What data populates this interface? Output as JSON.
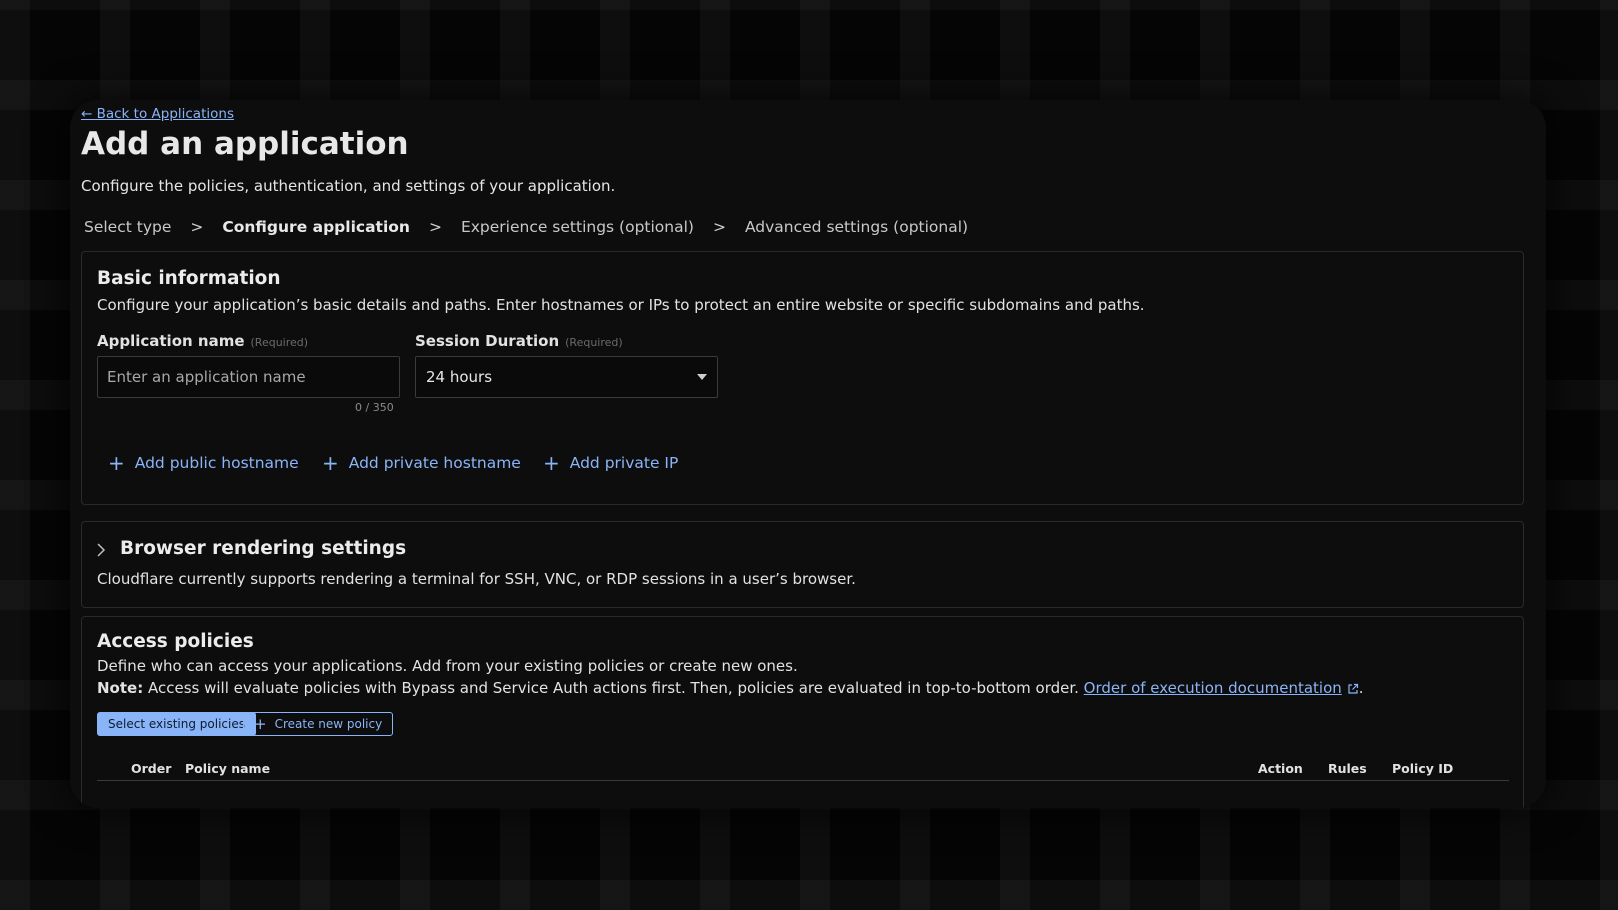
{
  "nav": {
    "back_link": "← Back to Applications"
  },
  "header": {
    "title": "Add an application",
    "subtitle": "Configure the policies, authentication, and settings of your application."
  },
  "steps": [
    {
      "label": "Select type",
      "active": false
    },
    {
      "label": "Configure application",
      "active": true
    },
    {
      "label": "Experience settings (optional)",
      "active": false
    },
    {
      "label": "Advanced settings (optional)",
      "active": false
    }
  ],
  "step_separator": ">",
  "basic_info": {
    "title": "Basic information",
    "description": "Configure your application’s basic details and paths. Enter hostnames or IPs to protect an entire website or specific subdomains and paths.",
    "app_name": {
      "label": "Application name",
      "required": "(Required)",
      "placeholder": "Enter an application name",
      "value": "",
      "counter": "0 / 350"
    },
    "session_duration": {
      "label": "Session Duration",
      "required": "(Required)",
      "value": "24 hours"
    },
    "add_public_hostname": "Add public hostname",
    "add_private_hostname": "Add private hostname",
    "add_private_ip": "Add private IP"
  },
  "browser_rendering": {
    "title": "Browser rendering settings",
    "description": "Cloudflare currently supports rendering a terminal for SSH, VNC, or RDP sessions in a user’s browser."
  },
  "access_policies": {
    "title": "Access policies",
    "description": "Define who can access your applications. Add from your existing policies or create new ones.",
    "note_label": "Note:",
    "note_text": " Access will evaluate policies with Bypass and Service Auth actions first. Then, policies are evaluated in top-to-bottom order. ",
    "doc_link": "Order of execution documentation",
    "note_end": ".",
    "select_existing_button": "Select existing policies",
    "create_new_button": "Create new policy",
    "table_headers": {
      "order": "Order",
      "policy_name": "Policy name",
      "action": "Action",
      "rules": "Rules",
      "policy_id": "Policy ID"
    }
  },
  "colors": {
    "accent": "#8ab4f8",
    "background": "#0d0d0d",
    "border": "#2a2a2a"
  }
}
